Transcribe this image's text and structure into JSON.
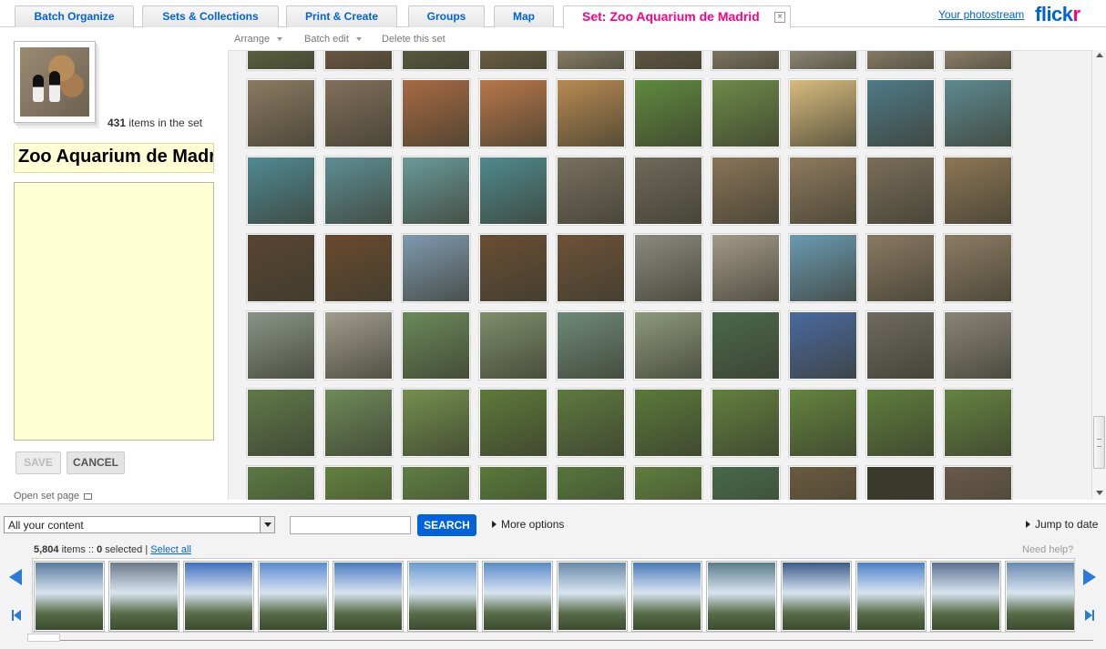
{
  "tabs": [
    {
      "label": "Batch Organize"
    },
    {
      "label": "Sets & Collections"
    },
    {
      "label": "Print & Create"
    },
    {
      "label": "Groups"
    },
    {
      "label": "Map"
    },
    {
      "label": "Set: Zoo Aquarium de Madrid",
      "active": true
    }
  ],
  "header": {
    "photostream_link": "Your photostream",
    "logo_part1": "flick",
    "logo_part2": "r"
  },
  "set": {
    "item_count": "431",
    "item_count_suffix": "items in the set",
    "title": "Zoo Aquarium de Madrid",
    "description": "",
    "save_label": "SAVE",
    "cancel_label": "CANCEL",
    "open_set_label": "Open set page"
  },
  "toolbar": {
    "arrange": "Arrange",
    "batch_edit": "Batch edit",
    "delete_set": "Delete this set"
  },
  "grid_photos": [
    "#6f7a4a",
    "#8a6a4e",
    "#6b6d47",
    "#8a7550",
    "#b8a98a",
    "#7a6850",
    "#a89a80",
    "#c4b8a0",
    "#b7a58a",
    "#c2ad90",
    "#8c7a62",
    "#826f5a",
    "#a86a42",
    "#b8774a",
    "#b88a52",
    "#5f8a3e",
    "#6d8a48",
    "#d8bb7e",
    "#4f7a88",
    "#5e8a90",
    "#4f8a94",
    "#5e8e94",
    "#6a9a9a",
    "#4f8a8e",
    "#7a7060",
    "#6f6a5a",
    "#8a7458",
    "#8f7a5e",
    "#7a6e5a",
    "#8e7656",
    "#5a4530",
    "#6a4a2e",
    "#7f9ab0",
    "#6a4e34",
    "#6e5238",
    "#8a8a80",
    "#a49a88",
    "#6a9ab2",
    "#8a7a62",
    "#8e7c64",
    "#8a9488",
    "#a09c8e",
    "#6a8a5a",
    "#7e8e6a",
    "#6e8a7a",
    "#8e9a7c",
    "#4a6a4a",
    "#4a6aa0",
    "#6e6a60",
    "#8a8478",
    "#5f7a4a",
    "#6e8a5a",
    "#74904e",
    "#5e7a3a",
    "#5e7a40",
    "#5a7a3a",
    "#62803e",
    "#64843e",
    "#5e7e3c",
    "#648440",
    "#5a7a42",
    "#62823e",
    "#5e7e42",
    "#587a3a",
    "#56763c",
    "#5e7e3e",
    "#466a4a",
    "#6a5a40",
    "#3a3a2a",
    "#6a5a4a"
  ],
  "search": {
    "content_filter": "All your content",
    "query": "",
    "search_label": "SEARCH",
    "more_options": "More options",
    "jump_to_date": "Jump to date"
  },
  "filmstrip": {
    "items_count": "5,804",
    "items_label": "items ::",
    "selected_count": "0",
    "selected_label": "selected |",
    "select_all": "Select all",
    "need_help": "Need help?",
    "photos": [
      "#5a7a9e",
      "#6a7a8a",
      "#3f6fbf",
      "#5a8ad0",
      "#4a7ac0",
      "#6a9ad0",
      "#5a8ac8",
      "#6a8aa8",
      "#4a7ab8",
      "#5a7a8a",
      "#3a5a8a",
      "#4a80c8",
      "#5a7090",
      "#6a8ab0"
    ]
  }
}
